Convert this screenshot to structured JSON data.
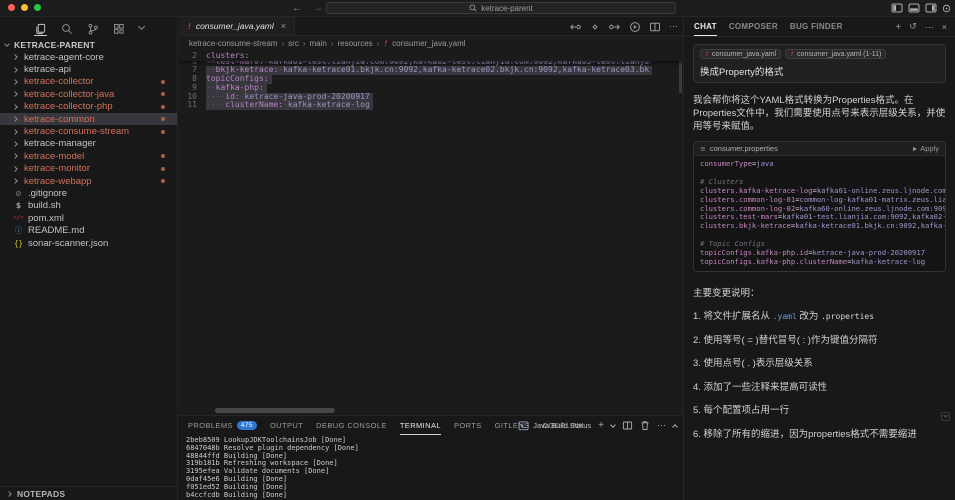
{
  "titlebar": {
    "search_value": "ketrace-parent"
  },
  "activity_bar": {
    "icons": [
      "explorer",
      "search",
      "source-control",
      "extensions",
      "more"
    ]
  },
  "sidebar": {
    "root_label": "KETRACE-PARENT",
    "notepads_label": "NOTEPADS",
    "items": [
      {
        "label": "ketrace-agent-core",
        "type": "folder",
        "modified": false
      },
      {
        "label": "ketrace-api",
        "type": "folder",
        "modified": false
      },
      {
        "label": "ketrace-collector",
        "type": "folder",
        "modified": true
      },
      {
        "label": "ketrace-collector-java",
        "type": "folder",
        "modified": true
      },
      {
        "label": "ketrace-collector-php",
        "type": "folder",
        "modified": true
      },
      {
        "label": "ketrace-common",
        "type": "folder",
        "modified": true,
        "selected": true
      },
      {
        "label": "ketrace-consume-stream",
        "type": "folder",
        "modified": true
      },
      {
        "label": "ketrace-manager",
        "type": "folder",
        "modified": false
      },
      {
        "label": "ketrace-model",
        "type": "folder",
        "modified": true
      },
      {
        "label": "ketrace-monitor",
        "type": "folder",
        "modified": true
      },
      {
        "label": "ketrace-webapp",
        "type": "folder",
        "modified": true
      },
      {
        "label": ".gitignore",
        "type": "file",
        "icon": "ignore"
      },
      {
        "label": "build.sh",
        "type": "file",
        "icon": "shell"
      },
      {
        "label": "pom.xml",
        "type": "file",
        "icon": "xml"
      },
      {
        "label": "README.md",
        "type": "file",
        "icon": "markdown"
      },
      {
        "label": "sonar-scanner.json",
        "type": "file",
        "icon": "json"
      }
    ],
    "icon_glyphs": {
      "ignore": "⊘",
      "shell": "$",
      "xml": "</>",
      "markdown": "ⓘ",
      "json": "{}"
    }
  },
  "editor": {
    "tab_label": "consumer_java.yaml",
    "breadcrumbs": [
      "ketrace-consume-stream",
      "src",
      "main",
      "resources",
      "consumer_java.yaml"
    ],
    "lines": [
      {
        "num": "2",
        "indent": 0,
        "key": "clusters",
        "value": "",
        "sticky": true
      },
      {
        "num": "6",
        "indent": 2,
        "key": "test-mars",
        "value": "kafka01-test.lianjia.com:9092,kafka02-test.lianjia.com:9092,kafka03-test.lianji",
        "partial": true
      },
      {
        "num": "7",
        "indent": 2,
        "key": "bkjk-ketrace",
        "value": "kafka-ketrace01.bkjk.cn:9092,kafka-ketrace02.bkjk.cn:9092,kafka-ketrace03.bk"
      },
      {
        "num": "8",
        "indent": 0,
        "key": "topicConfigs",
        "value": ""
      },
      {
        "num": "9",
        "indent": 2,
        "key": "kafka-php",
        "value": ""
      },
      {
        "num": "10",
        "indent": 4,
        "key": "id",
        "value": "ketrace-java-prod-20200917"
      },
      {
        "num": "11",
        "indent": 4,
        "key": "clusterName",
        "value": "kafka-ketrace-log"
      }
    ]
  },
  "panel": {
    "tabs": [
      {
        "label": "PROBLEMS",
        "badge": "475"
      },
      {
        "label": "OUTPUT"
      },
      {
        "label": "DEBUG CONSOLE"
      },
      {
        "label": "TERMINAL",
        "active": true
      },
      {
        "label": "PORTS"
      },
      {
        "label": "GITLENS"
      },
      {
        "label": "CODELINK"
      }
    ],
    "profile_label": "Java Build Status",
    "terminal_lines": [
      "2beb8509 LookupJDKToolchainsJob [Done]",
      "6847048b Resolve plugin dependency [Done]",
      "48844ffd Building [Done]",
      "319b181b Refreshing workspace [Done]",
      "3195efea Validate documents [Done]",
      "0daf45e6 Building [Done]",
      "f051ed52 Building [Done]",
      "b4ccfcdb Building [Done]"
    ]
  },
  "chat": {
    "tabs": [
      {
        "label": "CHAT",
        "active": true
      },
      {
        "label": "COMPOSER"
      },
      {
        "label": "BUG FINDER"
      }
    ],
    "chips": [
      "consumer_java.yaml",
      "consumer_java.yaml (1-11)"
    ],
    "user_message": "换成Property的格式",
    "assistant_intro": "我会帮你将这个YAML格式转换为Properties格式。在Properties文件中，我们需要使用点号来表示层级关系，并使用等号来赋值。",
    "code_filename": "consumer.properties",
    "apply_label": "Apply",
    "code_lines": [
      {
        "t": "kv",
        "k": "consumerType",
        "v": "java"
      },
      {
        "t": "blank"
      },
      {
        "t": "comment",
        "text": "# Clusters"
      },
      {
        "t": "kv",
        "k": "clusters.kafka-ketrace-log",
        "v": "kafka01-online.zeus.ljnode.com:9092,"
      },
      {
        "t": "kv",
        "k": "clusters.common-log-01",
        "v": "common-log-kafka01-matrix.zeus.lianjia.c"
      },
      {
        "t": "kv",
        "k": "clusters.common-log-02",
        "v": "kafka60-online.zeus.ljnode.com:9092,kafk"
      },
      {
        "t": "kv",
        "k": "clusters.test-mars",
        "v": "kafka01-test.lianjia.com:9092,kafka02-test.l"
      },
      {
        "t": "kv",
        "k": "clusters.bkjk-ketrace",
        "v": "kafka-ketrace01.bkjk.cn:9092,kafka-ketrac"
      },
      {
        "t": "blank"
      },
      {
        "t": "comment",
        "text": "# Topic Configs"
      },
      {
        "t": "kv",
        "k": "topicConfigs.kafka-php.id",
        "v": "ketrace-java-prod-20200917"
      },
      {
        "t": "kv",
        "k": "topicConfigs.kafka-php.clusterName",
        "v": "kafka-ketrace-log"
      }
    ],
    "changes_title": "主要变更说明：",
    "changes": [
      {
        "segs": [
          {
            "text": "1. 将文件扩展名从 "
          },
          {
            "text": ".yaml",
            "style": "code-accent"
          },
          {
            "text": " 改为 "
          },
          {
            "text": ".properties",
            "style": "code"
          }
        ]
      },
      {
        "segs": [
          {
            "text": "2. 使用等号( = )替代冒号( : )作为键值分隔符"
          }
        ]
      },
      {
        "segs": [
          {
            "text": "3. 使用点号( . )表示层级关系"
          }
        ]
      },
      {
        "segs": [
          {
            "text": "4. 添加了一些注释来提高可读性"
          }
        ]
      },
      {
        "segs": [
          {
            "text": "5. 每个配置项占用一行"
          }
        ]
      },
      {
        "segs": [
          {
            "text": "6. 移除了所有的缩进，因为properties格式不需要缩进"
          }
        ]
      }
    ]
  }
}
